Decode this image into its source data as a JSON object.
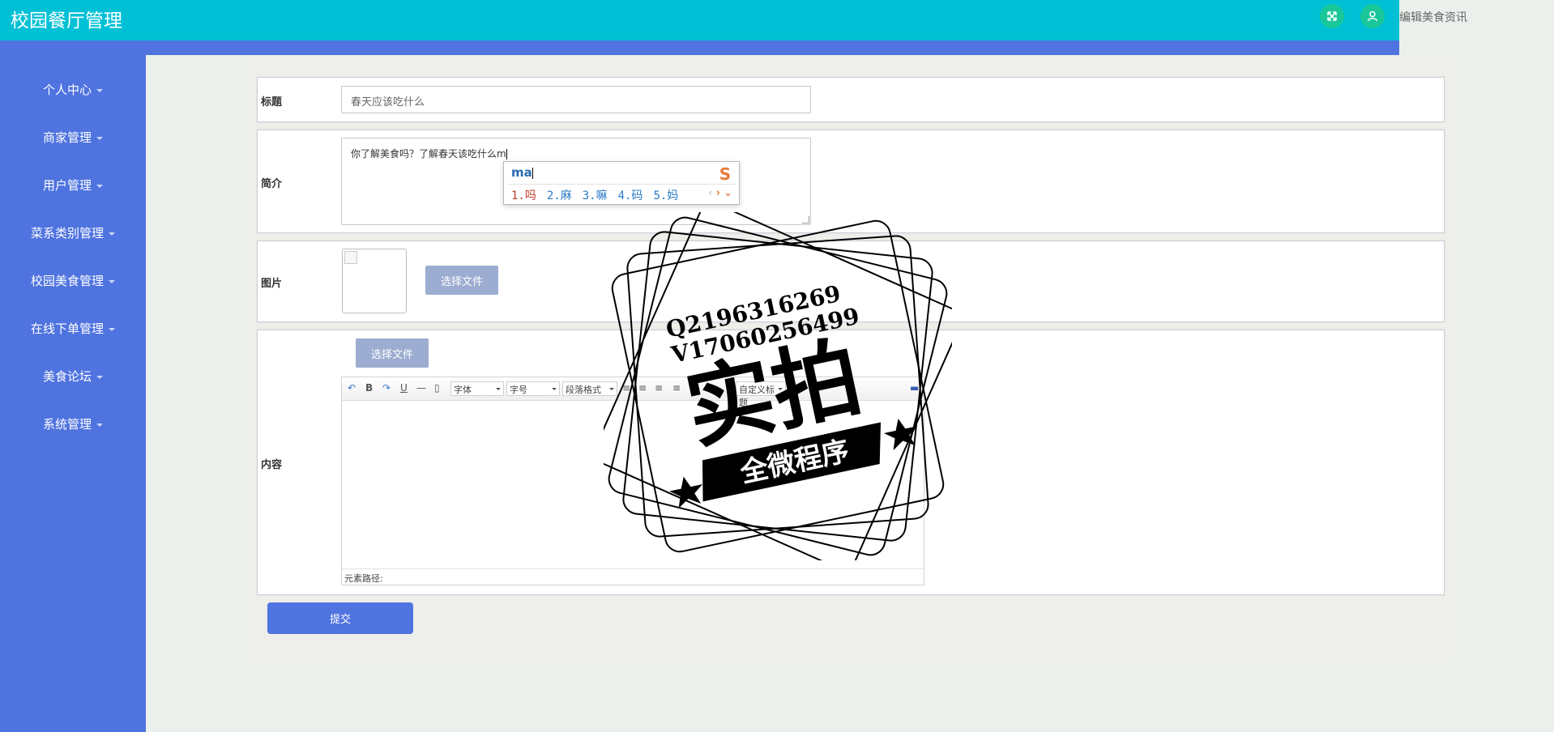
{
  "app": {
    "title": "校园餐厅管理",
    "top_right_text": "编辑美食资讯"
  },
  "sidebar": {
    "items": [
      {
        "label": "个人中心"
      },
      {
        "label": "商家管理"
      },
      {
        "label": "用户管理"
      },
      {
        "label": "菜系类别管理"
      },
      {
        "label": "校园美食管理"
      },
      {
        "label": "在线下单管理"
      },
      {
        "label": "美食论坛"
      },
      {
        "label": "系统管理"
      }
    ]
  },
  "form": {
    "title_label": "标题",
    "title_value": "春天应该吃什么",
    "intro_label": "简介",
    "intro_value": "你了解美食吗？了解春天该吃什么m",
    "image_label": "图片",
    "choose_file": "选择文件",
    "content_label": "内容",
    "submit": "提交"
  },
  "ime": {
    "pinyin": "ma",
    "candidates": [
      "1.吗",
      "2.麻",
      "3.嘛",
      "4.码",
      "5.妈"
    ]
  },
  "editor": {
    "font_family": "字体",
    "font_size": "字号",
    "paragraph": "段落格式",
    "custom_title": "自定义标题",
    "footer_path": "元素路径:"
  },
  "watermark": {
    "line1": "Q2196316269",
    "line2": "V17060256499",
    "big": "实拍",
    "banner": "全微程序"
  },
  "colors": {
    "topbar": "#00c0d6",
    "sidebar": "#4f73df",
    "icon_green": "#19c79a"
  }
}
